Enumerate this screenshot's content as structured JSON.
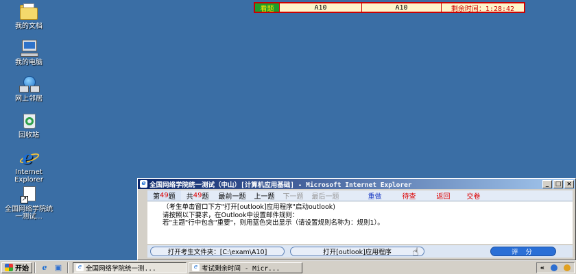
{
  "desktop": {
    "icons": [
      {
        "label": "我的文档"
      },
      {
        "label": "我的电脑"
      },
      {
        "label": "网上邻居"
      },
      {
        "label": "回收站"
      },
      {
        "label": "Internet\nExplorer"
      },
      {
        "label": "全国网络学院统\n一测试..."
      }
    ]
  },
  "timer_bar": {
    "status": "看题",
    "field1": "A10",
    "field2": "A10",
    "remaining": "剩余时间：1:28:42"
  },
  "window": {
    "title": "全国网络学院统一测试（中山）[计算机应用基础] - Microsoft Internet Explorer",
    "controls": {
      "minimize": "_",
      "restore": "□",
      "close": "×"
    },
    "nav": {
      "current_prefix": "第",
      "current_num": "49",
      "current_suffix": "题",
      "total_prefix": "共",
      "total_num": "49",
      "total_suffix": "题",
      "first": "最前一题",
      "prev": "上一题",
      "next": "下一题",
      "last": "最后一题",
      "redo": "重做",
      "review": "待查",
      "back": "返回",
      "submit": "交卷"
    },
    "content": {
      "line1": "（考生单击窗口下方\"打开[outlook]应用程序\"启动outlook)",
      "line2": "请按照以下要求，在Outlook中设置邮件规则：",
      "line3": "若\"主题\"行中包含\"重要\"，则用蓝色突出显示（请设置规则名称为：规则1）。"
    },
    "buttons": {
      "open_folder": "打开考生文件夹：[C:\\exam\\A10]",
      "open_app": "打开[outlook]应用程序",
      "grade": "评 分"
    }
  },
  "taskbar": {
    "start": "开始",
    "tasks": [
      {
        "label": "全国网络学院统一测..."
      },
      {
        "label": "考试剩余时间 - Micr..."
      }
    ],
    "tray_arrow": "«"
  },
  "colors": {
    "desktop": "#3a6ea5",
    "title_start": "#0a246a",
    "title_end": "#a6caf0",
    "highlight_red": "#d00",
    "highlight_blue": "#1d3cc4"
  }
}
